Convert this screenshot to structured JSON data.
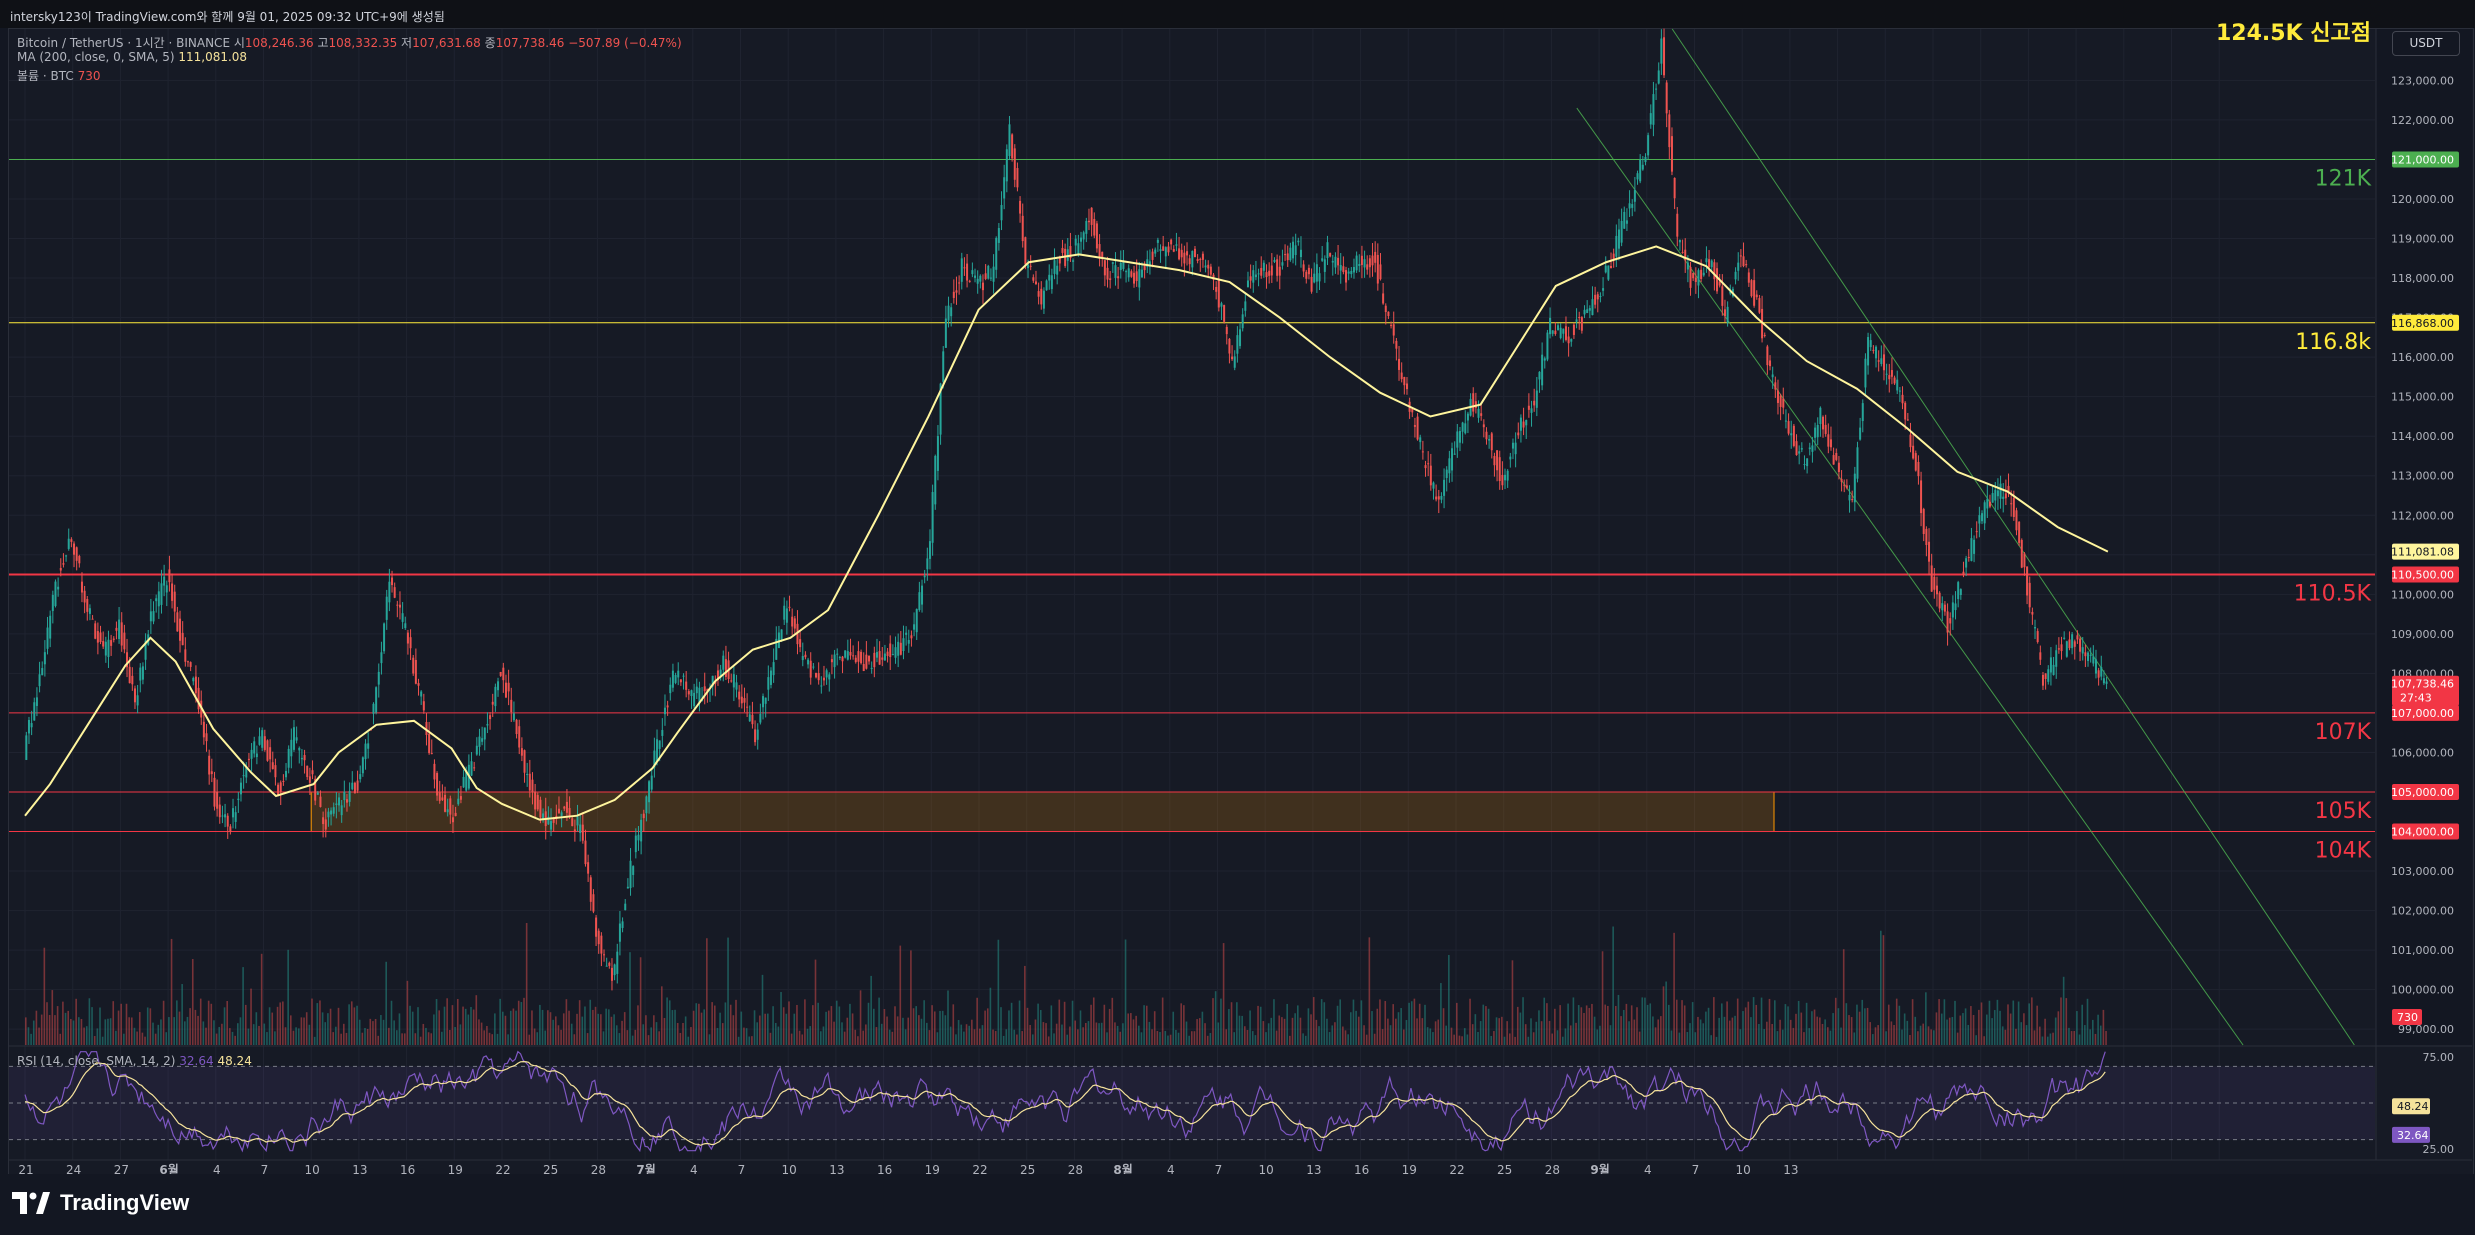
{
  "header": {
    "caption": "intersky123이 TradingView.com와 함께 9월 01, 2025 09:32 UTC+9에 생성됨"
  },
  "legend": {
    "symbol": "Bitcoin / TetherUS · 1시간 · BINANCE",
    "open_label": "시",
    "open": "108,246.36",
    "high_label": "고",
    "high": "108,332.35",
    "low_label": "저",
    "low": "107,631.68",
    "close_label": "종",
    "close": "107,738.46",
    "change": "−507.89 (−0.47%)",
    "ma_label": "MA (200, close, 0, SMA, 5)",
    "ma_value": "111,081.08",
    "volume_label": "볼륨 · BTC",
    "volume_value": "730"
  },
  "currency_button": "USDT",
  "rsi_legend": {
    "label": "RSI (14, close, SMA, 14, 2)",
    "value1": "32.64",
    "value2": "48.24"
  },
  "brand": "TradingView",
  "colors": {
    "background": "#161a25",
    "up": "#26a69a",
    "down": "#ef5350",
    "ma": "#fff59d",
    "rsi": "#7e57c2",
    "rsi_ma": "#f5e29b",
    "green_line": "#4caf50",
    "yellow_line": "#ffeb3b",
    "red_line": "#f23645",
    "zone": "#ff9800"
  },
  "chart_data": {
    "type": "candlestick",
    "title": "Bitcoin / TetherUS · 1시간 · BINANCE",
    "ylim": [
      98600,
      124300
    ],
    "y_ticks": [
      99000,
      100000,
      101000,
      102000,
      103000,
      104000,
      105000,
      106000,
      107000,
      108000,
      109000,
      110000,
      111000,
      112000,
      113000,
      114000,
      115000,
      116000,
      117000,
      118000,
      119000,
      120000,
      121000,
      122000,
      123000
    ],
    "y_tick_labels": [
      "99,000.00",
      "100,000.00",
      "101,000.00",
      "102,000.00",
      "103,000.00",
      "104,000.00",
      "105,000.00",
      "106,000.00",
      "107,000.00",
      "108,000.00",
      "109,000.00",
      "110,000.00",
      "111,000.00",
      "112,000.00",
      "113,000.00",
      "114,000.00",
      "115,000.00",
      "116,000.00",
      "117,000.00",
      "118,000.00",
      "119,000.00",
      "120,000.00",
      "121,000.00",
      "122,000.00",
      "123,000.00"
    ],
    "x_labels": [
      "21",
      "24",
      "27",
      "6월",
      "4",
      "7",
      "10",
      "13",
      "16",
      "19",
      "22",
      "25",
      "28",
      "7월",
      "4",
      "7",
      "10",
      "13",
      "16",
      "19",
      "22",
      "25",
      "28",
      "8월",
      "4",
      "7",
      "10",
      "13",
      "16",
      "19",
      "22",
      "25",
      "28",
      "9월",
      "4",
      "7",
      "10",
      "13"
    ],
    "x_start_day": 0,
    "price_path": [
      [
        0,
        106000
      ],
      [
        1,
        107800
      ],
      [
        2,
        110200
      ],
      [
        3,
        111500
      ],
      [
        4,
        109600
      ],
      [
        5,
        108500
      ],
      [
        6,
        109200
      ],
      [
        7,
        107200
      ],
      [
        8,
        109500
      ],
      [
        9,
        110400
      ],
      [
        10,
        108700
      ],
      [
        11,
        107300
      ],
      [
        12,
        104800
      ],
      [
        13,
        104200
      ],
      [
        14,
        105800
      ],
      [
        15,
        106400
      ],
      [
        16,
        105000
      ],
      [
        17,
        106400
      ],
      [
        18,
        105400
      ],
      [
        19,
        104200
      ],
      [
        20,
        104700
      ],
      [
        21,
        105200
      ],
      [
        22,
        107100
      ],
      [
        23,
        110300
      ],
      [
        24,
        109100
      ],
      [
        25,
        107300
      ],
      [
        26,
        105000
      ],
      [
        27,
        104400
      ],
      [
        28,
        105500
      ],
      [
        29,
        106500
      ],
      [
        30,
        108100
      ],
      [
        31,
        106500
      ],
      [
        32,
        104800
      ],
      [
        33,
        104200
      ],
      [
        34,
        104500
      ],
      [
        35,
        104100
      ],
      [
        36,
        101500
      ],
      [
        37,
        100200
      ],
      [
        38,
        102800
      ],
      [
        39,
        104500
      ],
      [
        40,
        106500
      ],
      [
        41,
        108100
      ],
      [
        42,
        107400
      ],
      [
        43,
        107600
      ],
      [
        44,
        108200
      ],
      [
        45,
        107500
      ],
      [
        46,
        106400
      ],
      [
        47,
        108100
      ],
      [
        48,
        109800
      ],
      [
        49,
        108300
      ],
      [
        50,
        107800
      ],
      [
        51,
        108300
      ],
      [
        52,
        108700
      ],
      [
        53,
        108200
      ],
      [
        54,
        108500
      ],
      [
        55,
        108600
      ],
      [
        56,
        109100
      ],
      [
        57,
        111500
      ],
      [
        58,
        117000
      ],
      [
        59,
        118300
      ],
      [
        60,
        117800
      ],
      [
        61,
        118200
      ],
      [
        62,
        121800
      ],
      [
        63,
        118500
      ],
      [
        64,
        117300
      ],
      [
        65,
        118500
      ],
      [
        66,
        118600
      ],
      [
        67,
        119600
      ],
      [
        68,
        118200
      ],
      [
        69,
        118200
      ],
      [
        70,
        118000
      ],
      [
        71,
        118700
      ],
      [
        72,
        118800
      ],
      [
        73,
        118500
      ],
      [
        74,
        118500
      ],
      [
        75,
        117800
      ],
      [
        76,
        115800
      ],
      [
        77,
        117900
      ],
      [
        78,
        118200
      ],
      [
        79,
        118300
      ],
      [
        80,
        118900
      ],
      [
        81,
        117800
      ],
      [
        82,
        118700
      ],
      [
        83,
        118000
      ],
      [
        84,
        118500
      ],
      [
        85,
        118400
      ],
      [
        86,
        116600
      ],
      [
        87,
        115000
      ],
      [
        88,
        113500
      ],
      [
        89,
        112300
      ],
      [
        90,
        113700
      ],
      [
        91,
        114900
      ],
      [
        92,
        114100
      ],
      [
        93,
        112900
      ],
      [
        94,
        114200
      ],
      [
        95,
        114900
      ],
      [
        96,
        116800
      ],
      [
        97,
        116500
      ],
      [
        98,
        116900
      ],
      [
        99,
        117600
      ],
      [
        100,
        118600
      ],
      [
        101,
        119900
      ],
      [
        102,
        121200
      ],
      [
        103,
        123900
      ],
      [
        104,
        119000
      ],
      [
        105,
        117800
      ],
      [
        106,
        118500
      ],
      [
        107,
        117100
      ],
      [
        108,
        118700
      ],
      [
        109,
        117300
      ],
      [
        110,
        115400
      ],
      [
        111,
        114200
      ],
      [
        112,
        113300
      ],
      [
        113,
        114500
      ],
      [
        114,
        113200
      ],
      [
        115,
        112300
      ],
      [
        116,
        116400
      ],
      [
        117,
        115800
      ],
      [
        118,
        115100
      ],
      [
        119,
        113300
      ],
      [
        120,
        110200
      ],
      [
        121,
        109200
      ],
      [
        122,
        110600
      ],
      [
        123,
        111800
      ],
      [
        124,
        112700
      ],
      [
        125,
        112500
      ],
      [
        126,
        110100
      ],
      [
        127,
        107800
      ],
      [
        128,
        108600
      ],
      [
        129,
        108800
      ],
      [
        130,
        108300
      ],
      [
        131,
        107738
      ]
    ],
    "ma_path": [
      [
        0,
        104400
      ],
      [
        2,
        105200
      ],
      [
        5,
        106700
      ],
      [
        8,
        108200
      ],
      [
        10,
        108900
      ],
      [
        12,
        108300
      ],
      [
        15,
        106600
      ],
      [
        18,
        105500
      ],
      [
        20,
        104900
      ],
      [
        23,
        105200
      ],
      [
        25,
        106000
      ],
      [
        28,
        106700
      ],
      [
        31,
        106800
      ],
      [
        34,
        106100
      ],
      [
        36,
        105100
      ],
      [
        38,
        104700
      ],
      [
        41,
        104300
      ],
      [
        44,
        104400
      ],
      [
        47,
        104800
      ],
      [
        50,
        105600
      ],
      [
        52,
        106500
      ],
      [
        55,
        107800
      ],
      [
        58,
        108600
      ],
      [
        61,
        108900
      ],
      [
        64,
        109600
      ],
      [
        68,
        112000
      ],
      [
        72,
        114500
      ],
      [
        76,
        117200
      ],
      [
        80,
        118400
      ],
      [
        84,
        118600
      ],
      [
        88,
        118400
      ],
      [
        92,
        118200
      ],
      [
        96,
        117900
      ],
      [
        100,
        117000
      ],
      [
        104,
        116000
      ],
      [
        108,
        115100
      ],
      [
        112,
        114500
      ],
      [
        116,
        114800
      ],
      [
        119,
        116300
      ],
      [
        122,
        117800
      ],
      [
        126,
        118400
      ],
      [
        130,
        118800
      ],
      [
        134,
        118300
      ],
      [
        138,
        117000
      ],
      [
        142,
        115900
      ],
      [
        146,
        115200
      ],
      [
        150,
        114200
      ],
      [
        154,
        113100
      ],
      [
        158,
        112600
      ],
      [
        162,
        111700
      ],
      [
        166,
        111080
      ]
    ],
    "ma_x_offset": 0,
    "horizontal_levels": [
      {
        "value": 121000,
        "color": "#4caf50",
        "label": "121K",
        "axis_label": "121,000.00"
      },
      {
        "value": 116868,
        "color": "#ffeb3b",
        "label": "116.8k",
        "axis_label": "116,868.00"
      },
      {
        "value": 110500,
        "color": "#f23645",
        "label": "110.5K",
        "axis_label": "110,500.00"
      },
      {
        "value": 107000,
        "color": "#f23645",
        "label": "107K",
        "axis_label": "107,000.00"
      },
      {
        "value": 105000,
        "color": "#f23645",
        "label": "105K",
        "axis_label": "105,000.00"
      },
      {
        "value": 104000,
        "color": "#f23645",
        "label": "104K",
        "axis_label": "104,000.00"
      }
    ],
    "annotations": [
      {
        "text": "124.5K 신고점",
        "value": 124500,
        "color": "#ffeb3b"
      }
    ],
    "current_price": {
      "value": 107738.46,
      "axis_label": "107,738.46",
      "countdown": "27:43"
    },
    "ma_last_label": {
      "value": 111081.08,
      "axis_label": "111,081.08"
    },
    "volume_last_label": "730",
    "rsi": {
      "ylim": [
        20,
        80
      ],
      "ticks": [
        25,
        75
      ],
      "tick_labels": [
        "25.00",
        "75.00"
      ],
      "upper": 70,
      "lower": 30,
      "last": 32.64,
      "last_ma": 48.24
    }
  }
}
